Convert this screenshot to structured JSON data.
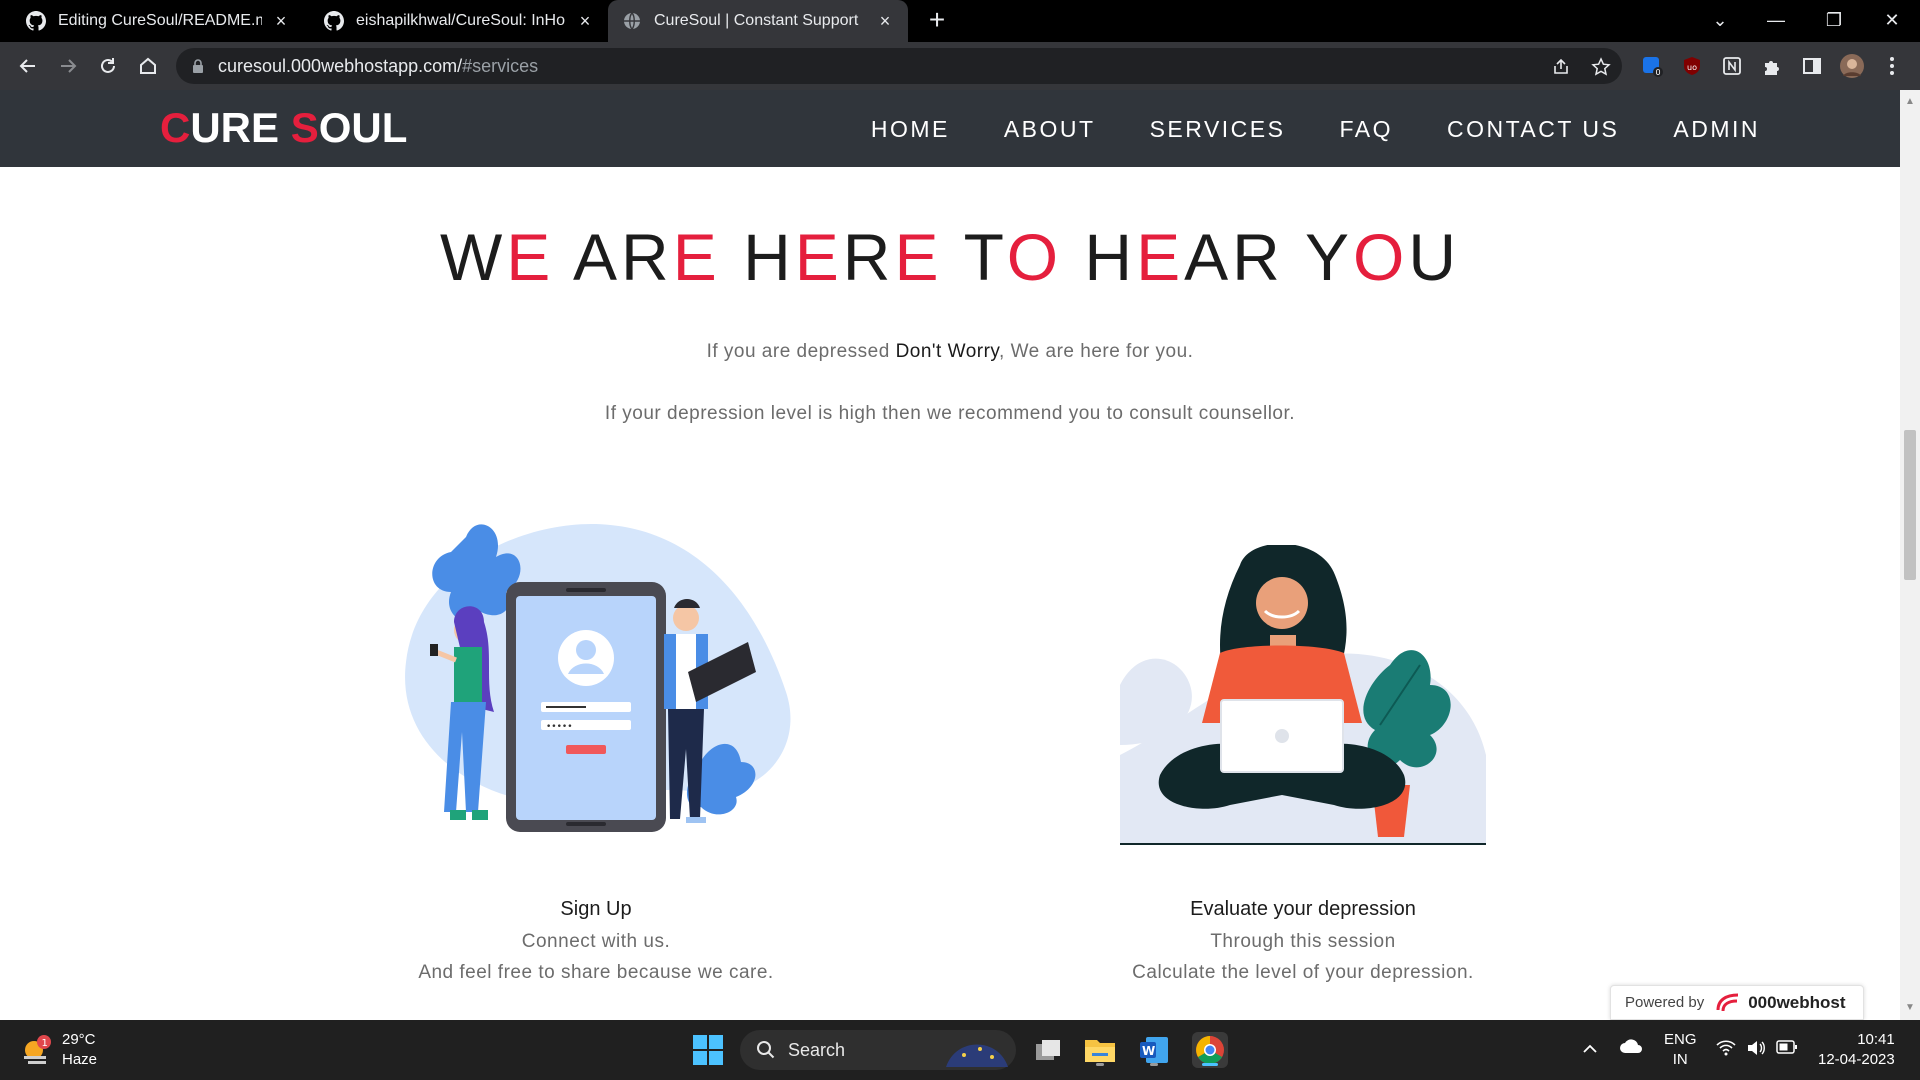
{
  "browser": {
    "tabs": [
      {
        "title": "Editing CureSoul/README.md at",
        "icon": "github-icon"
      },
      {
        "title": "eishapilkhwal/CureSoul: InHouse",
        "icon": "github-icon"
      },
      {
        "title": "CureSoul | Constant Support",
        "icon": "globe-icon"
      }
    ],
    "url_host": "curesoul.000webhostapp.com/",
    "url_hash": "#services"
  },
  "site": {
    "logo_c": "C",
    "logo_ure": "URE ",
    "logo_s": "S",
    "logo_oul": "OUL",
    "nav": [
      "HOME",
      "ABOUT",
      "SERVICES",
      "FAQ",
      "CONTACT US",
      "ADMIN"
    ]
  },
  "hero": {
    "title_parts": [
      "W",
      "E",
      " AR",
      "E",
      " H",
      "E",
      "R",
      "E",
      " T",
      "O",
      " H",
      "E",
      "AR Y",
      "O",
      "U"
    ],
    "tagline_before": "If you are depressed ",
    "tagline_bold": "Don't Worry",
    "tagline_after": ", We are here for you.",
    "subline": "If your depression level is high then we recommend you to consult counsellor."
  },
  "cards": [
    {
      "title": "Sign Up",
      "line1": "Connect with us.",
      "line2": "And feel free to share because we care."
    },
    {
      "title": "Evaluate your depression",
      "line1": "Through this session",
      "line2": "Calculate the level of your depression."
    }
  ],
  "powered": {
    "label": "Powered by",
    "brand": "000webhost"
  },
  "taskbar": {
    "weather_temp": "29°C",
    "weather_desc": "Haze",
    "weather_badge": "1",
    "search_label": "Search",
    "lang_1": "ENG",
    "lang_2": "IN",
    "time": "10:41",
    "date": "12-04-2023"
  },
  "colors": {
    "accent": "#e51f3d",
    "header_bg": "#30353b"
  }
}
